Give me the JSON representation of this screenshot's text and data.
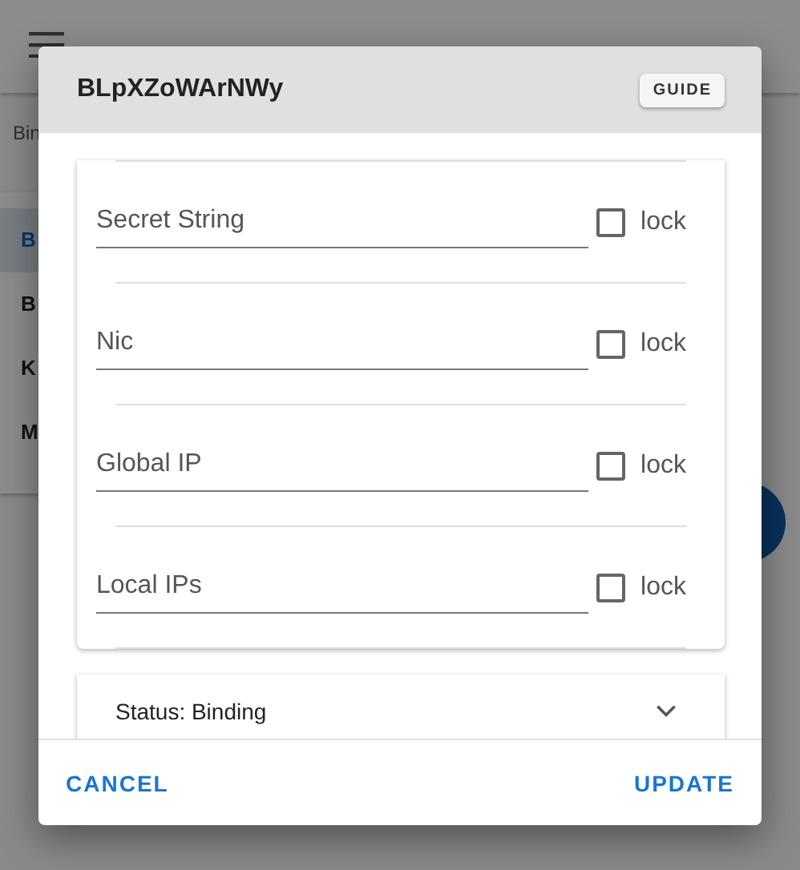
{
  "filter": {
    "label": "Bin"
  },
  "sidebar": {
    "items": [
      {
        "label": "B",
        "selected": true
      },
      {
        "label": "B",
        "selected": false
      },
      {
        "label": "K",
        "selected": false
      },
      {
        "label": "M",
        "selected": false
      }
    ]
  },
  "dialog": {
    "title": "BLpXZoWArNWy",
    "guide_button": "GUIDE",
    "fields": [
      {
        "label": "Secret String",
        "lock_label": "lock",
        "locked": false
      },
      {
        "label": "Nic",
        "lock_label": "lock",
        "locked": false
      },
      {
        "label": "Global IP",
        "lock_label": "lock",
        "locked": false
      },
      {
        "label": "Local IPs",
        "lock_label": "lock",
        "locked": false
      }
    ],
    "status_panel": {
      "label": "Status: Binding",
      "expanded": false
    },
    "actions": [
      {
        "label": "CANCEL"
      },
      {
        "label": "UPDATE"
      }
    ]
  }
}
